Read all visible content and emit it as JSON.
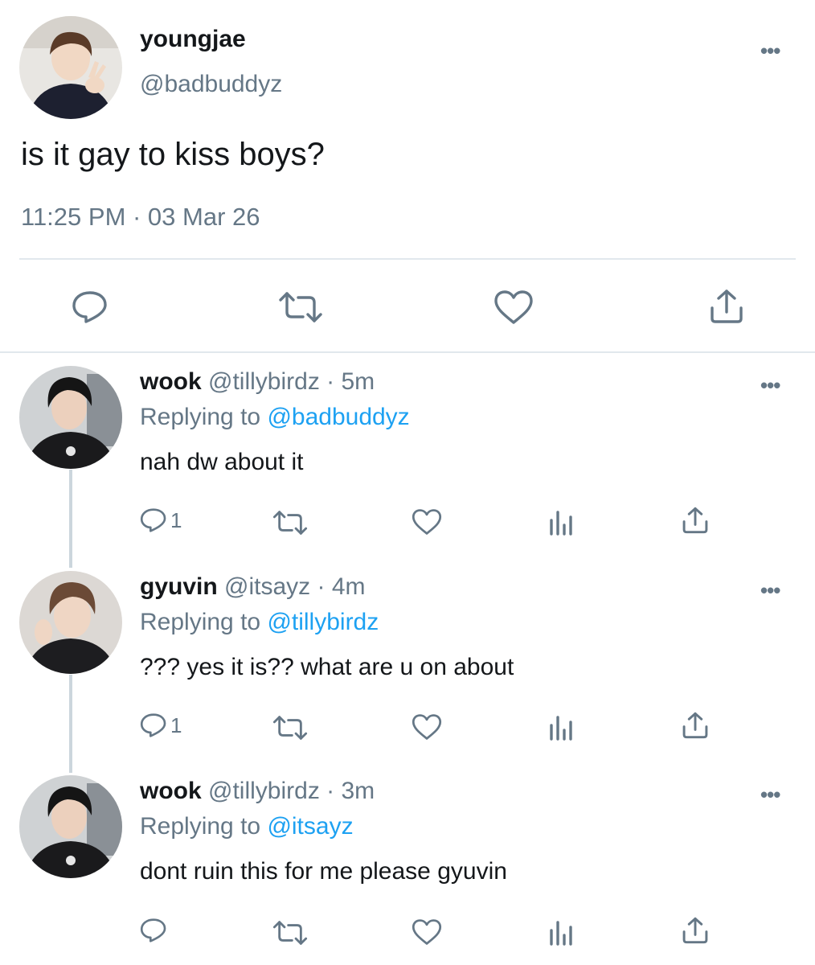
{
  "main_tweet": {
    "display_name": "youngjae",
    "handle": "@badbuddyz",
    "text": "is it gay to kiss boys?",
    "timestamp": "11:25 PM · 03 Mar 26",
    "more_icon": "ellipsis-icon",
    "actions": [
      "reply-icon",
      "retweet-icon",
      "like-icon",
      "share-icon"
    ]
  },
  "replies": [
    {
      "display_name": "wook",
      "handle": "@tillybirdz",
      "time": "· 5m",
      "replying_prefix": "Replying to",
      "replying_to": "@badbuddyz",
      "text": "nah dw about it",
      "reply_count": "1"
    },
    {
      "display_name": "gyuvin",
      "handle": "@itsayz",
      "time": "· 4m",
      "replying_prefix": "Replying to",
      "replying_to": "@tillybirdz",
      "text": "??? yes it is?? what are u on about",
      "reply_count": "1"
    },
    {
      "display_name": "wook",
      "handle": "@tillybirdz",
      "time": "· 3m",
      "replying_prefix": "Replying to",
      "replying_to": "@itsayz",
      "text": "dont ruin this for me please gyuvin",
      "reply_count": ""
    }
  ],
  "colors": {
    "text": "#14171a",
    "secondary": "#657786",
    "link": "#1da1f2",
    "divider": "#e1e8ed"
  }
}
